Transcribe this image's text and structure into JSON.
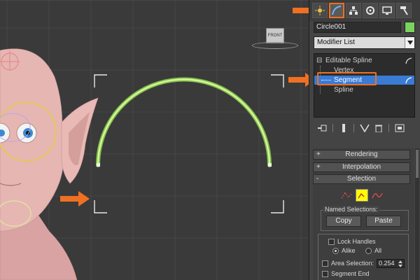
{
  "viewport": {
    "viewcube_label": "FRONT",
    "spline_color": "#b7f07a",
    "selection_bracket_color": "#e8e8e8"
  },
  "annotation": {
    "arrow_color": "#f07021"
  },
  "tabs": [
    {
      "name": "create-tab",
      "icon": "sun-icon",
      "active": false
    },
    {
      "name": "modify-tab",
      "icon": "modify-curve-icon",
      "active": true
    },
    {
      "name": "hierarchy-tab",
      "icon": "hierarchy-icon",
      "active": false
    },
    {
      "name": "motion-tab",
      "icon": "motion-icon",
      "active": false
    },
    {
      "name": "display-tab",
      "icon": "display-monitor-icon",
      "active": false
    },
    {
      "name": "utilities-tab",
      "icon": "hammer-icon",
      "active": false
    }
  ],
  "object": {
    "name": "Circle001",
    "color": "#7ad35e"
  },
  "modifier_list": {
    "label": "Modifier List"
  },
  "stack": {
    "expand_sign": "⊟",
    "items": [
      {
        "label": "Editable Spline",
        "level": 0
      },
      {
        "label": "Vertex",
        "level": 1
      },
      {
        "label": "Segment",
        "level": 1
      },
      {
        "label": "Spline",
        "level": 1
      }
    ],
    "selected_item": "Segment"
  },
  "rollouts": [
    {
      "sign": "+",
      "title": "Rendering"
    },
    {
      "sign": "+",
      "title": "Interpolation"
    },
    {
      "sign": "-",
      "title": "Selection"
    }
  ],
  "selection": {
    "named_selections_label": "Named Selections:",
    "copy_label": "Copy",
    "paste_label": "Paste",
    "lock_handles_label": "Lock Handles",
    "alike_label": "Alike",
    "all_label": "All",
    "area_selection_label": "Area Selection:",
    "area_selection_value": "0.254",
    "segment_end_label": "Segment End",
    "highlight_color": "#ffff00"
  }
}
